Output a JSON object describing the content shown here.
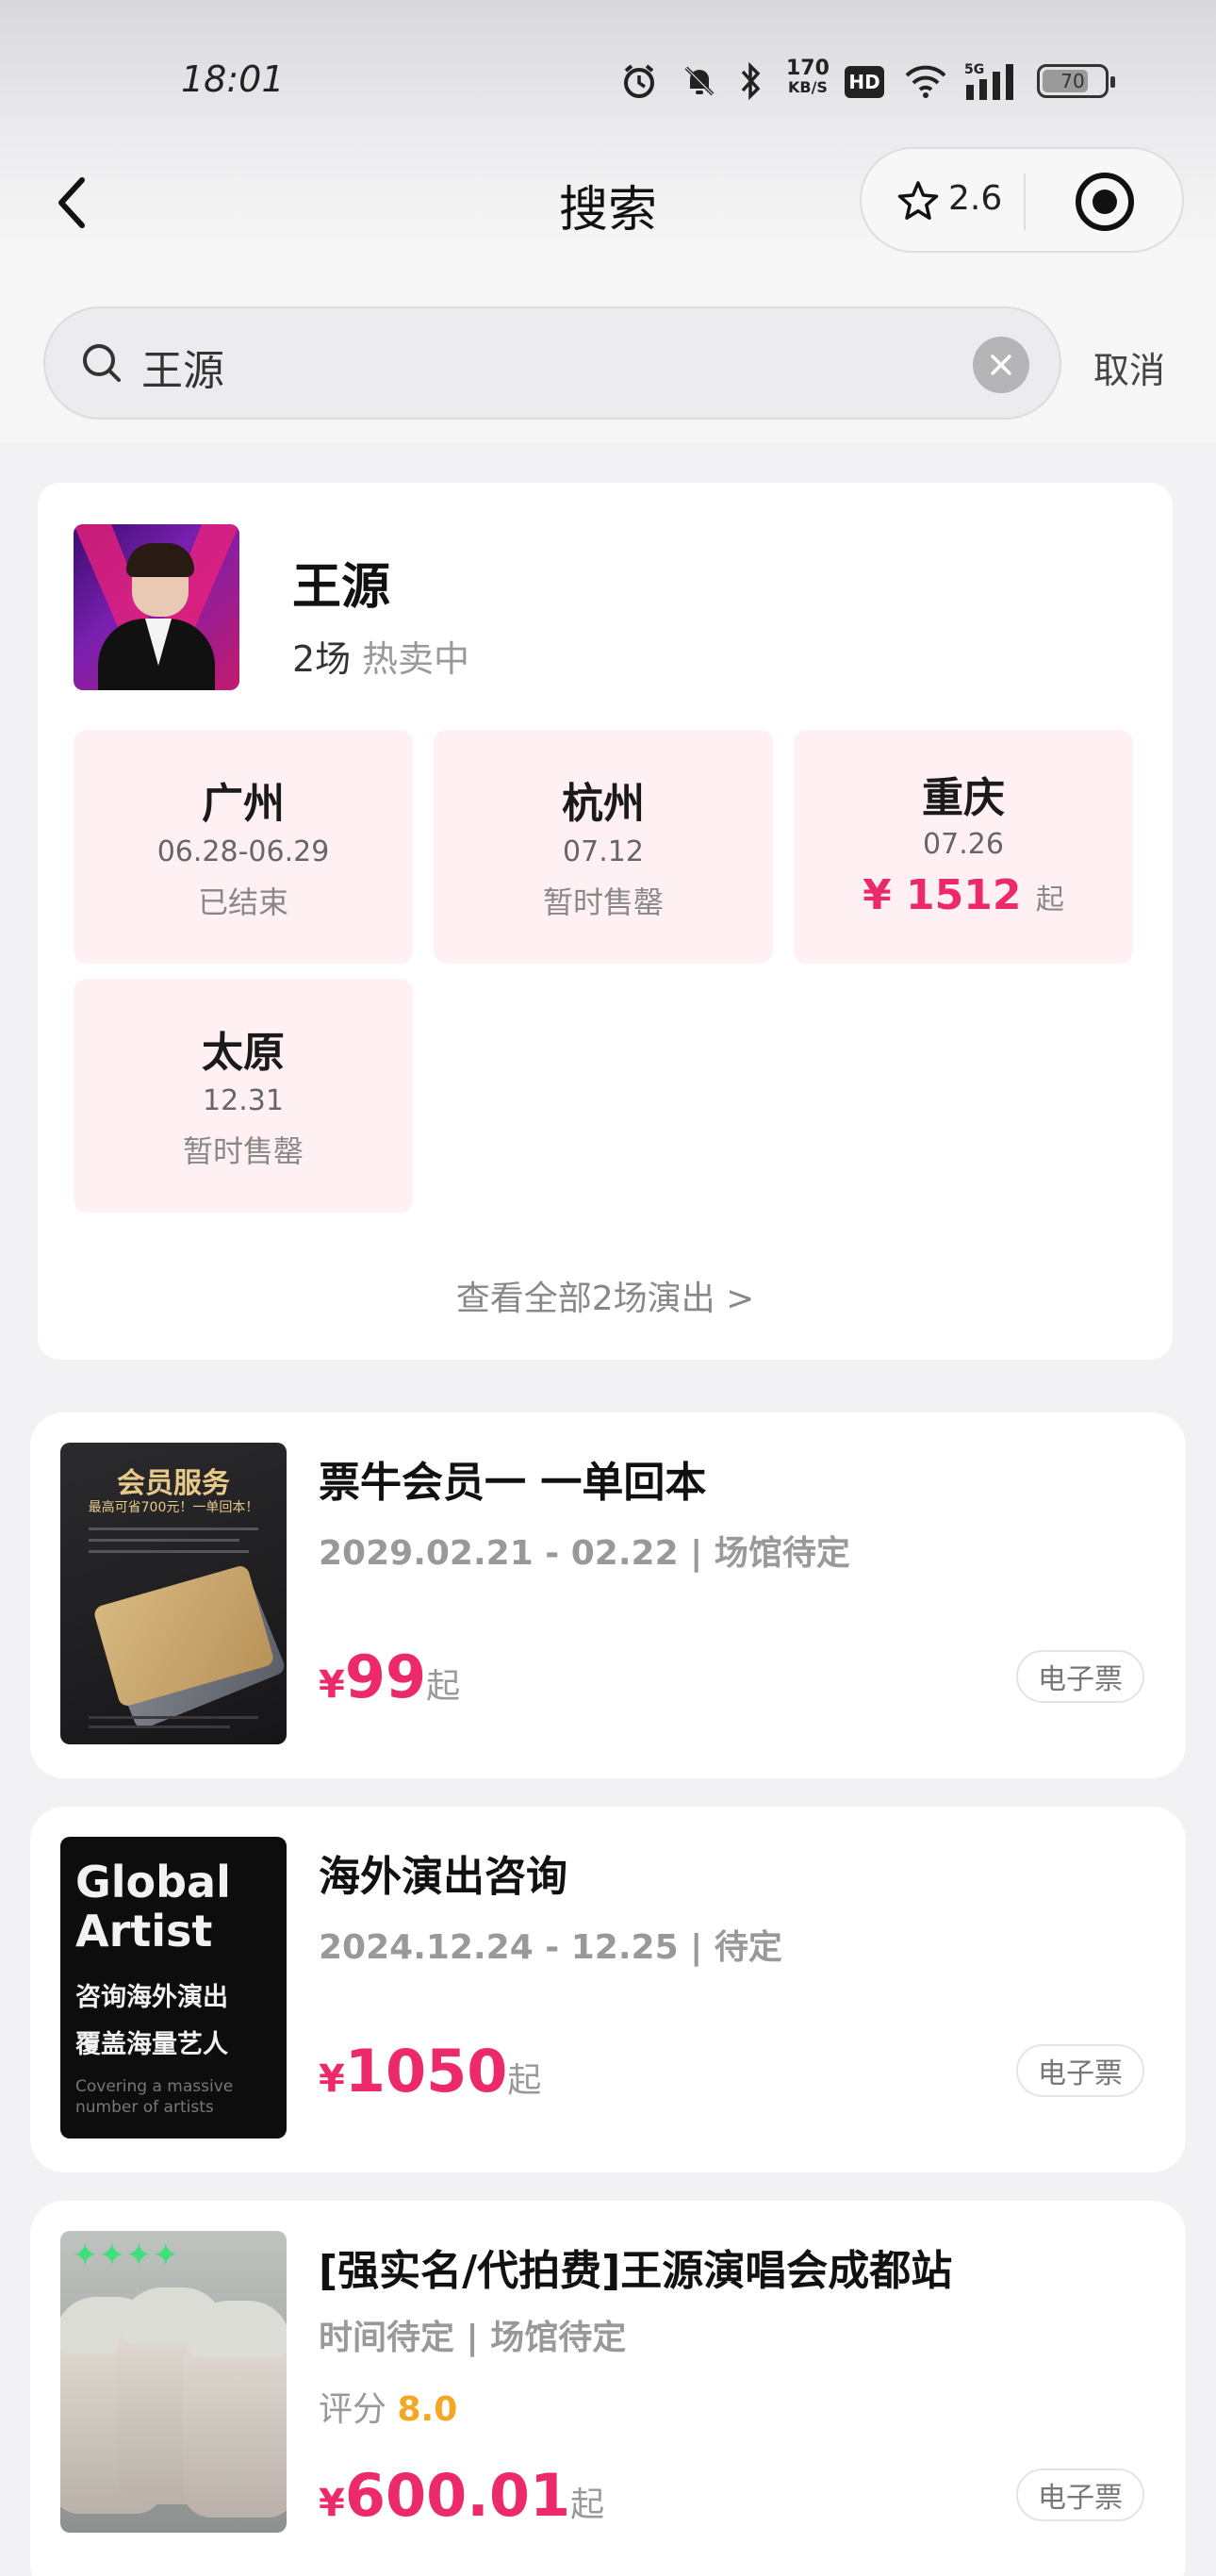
{
  "status_bar": {
    "time": "18:01",
    "net_speed_value": "170",
    "net_speed_unit": "KB/S",
    "hd_label": "HD",
    "network_label": "5G",
    "battery_level": "70",
    "icons": [
      "alarm-icon",
      "mute-icon",
      "bluetooth-icon",
      "wifi-icon",
      "signal-icon",
      "battery-icon"
    ]
  },
  "nav": {
    "title": "搜索",
    "rating": "2.6"
  },
  "search": {
    "value": "王源",
    "cancel_label": "取消"
  },
  "artist": {
    "name": "王源",
    "count": "2场",
    "status": "热卖中",
    "cities": [
      {
        "name": "广州",
        "date": "06.28-06.29",
        "status": "已结束"
      },
      {
        "name": "杭州",
        "date": "07.12",
        "status": "暂时售罄"
      },
      {
        "name": "重庆",
        "date": "07.26",
        "price": "¥ 1512",
        "price_suffix": "起"
      },
      {
        "name": "太原",
        "date": "12.31",
        "status": "暂时售罄"
      }
    ],
    "view_all": "查看全部2场演出 >"
  },
  "items": [
    {
      "title": "票牛会员一 一单回本",
      "subtitle": "2029.02.21 - 02.22 | 场馆待定",
      "price_currency": "¥",
      "price": "99",
      "price_suffix": "起",
      "ticket_type": "电子票",
      "thumb_heading": "会员服务",
      "thumb_sub": "最高可省700元！一单回本！"
    },
    {
      "title": "海外演出咨询",
      "subtitle": "2024.12.24 - 12.25 | 待定",
      "price_currency": "¥",
      "price": "1050",
      "price_suffix": "起",
      "ticket_type": "电子票",
      "thumb_line1": "Global",
      "thumb_line2": "Artist",
      "thumb_line3": "咨询海外演出",
      "thumb_line4": "覆盖海量艺人",
      "thumb_line5": "Covering a massive",
      "thumb_line6": "number of artists"
    },
    {
      "title": "[强实名/代拍费]王源演唱会成都站",
      "subtitle": "时间待定 | 场馆待定",
      "score_label": "评分",
      "score": "8.0",
      "price_currency": "¥",
      "price": "600.01",
      "price_suffix": "起",
      "ticket_type": "电子票"
    }
  ],
  "colors": {
    "accent_pink": "#ec2a6a",
    "score_orange": "#f5a623",
    "city_bg": "#fff1f3",
    "page_bg": "#f2f2f4"
  }
}
